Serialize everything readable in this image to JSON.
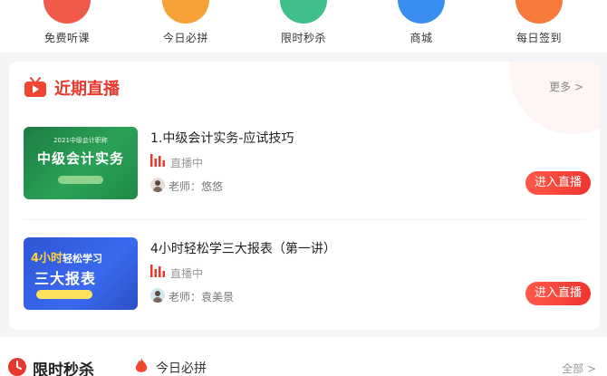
{
  "nav": {
    "items": [
      {
        "label": "免费听课",
        "icon": "play-icon",
        "color": "#f05a4a"
      },
      {
        "label": "今日必拼",
        "icon": "group-buy-icon",
        "color": "#f9a23a"
      },
      {
        "label": "限时秒杀",
        "icon": "flash-sale-icon",
        "color": "#3fc08a"
      },
      {
        "label": "商城",
        "icon": "shop-icon",
        "color": "#3a8ef0"
      },
      {
        "label": "每日签到",
        "icon": "calendar-icon",
        "color": "#f77a3b"
      }
    ]
  },
  "live": {
    "title": "近期直播",
    "more": "更多 >",
    "courses": [
      {
        "title": "1.中级会计实务-应试技巧",
        "status": "直播中",
        "teacher": "老师：悠悠",
        "button": "进入直播",
        "thumb": {
          "small": "2021中级会计职称",
          "big": "中级会计实务"
        }
      },
      {
        "title": "4小时轻松学三大报表（第一讲）",
        "status": "直播中",
        "teacher": "老师：袁美景",
        "button": "进入直播",
        "thumb": {
          "line1_a": "4小时",
          "line1_b": "轻松学习",
          "line2": "三大报表"
        }
      }
    ]
  },
  "bottom": {
    "title": "限时秒杀",
    "tab": "今日必拼",
    "all": "全部 >"
  },
  "colors": {
    "accent": "#e8392f",
    "live_button": "#f0352e"
  }
}
